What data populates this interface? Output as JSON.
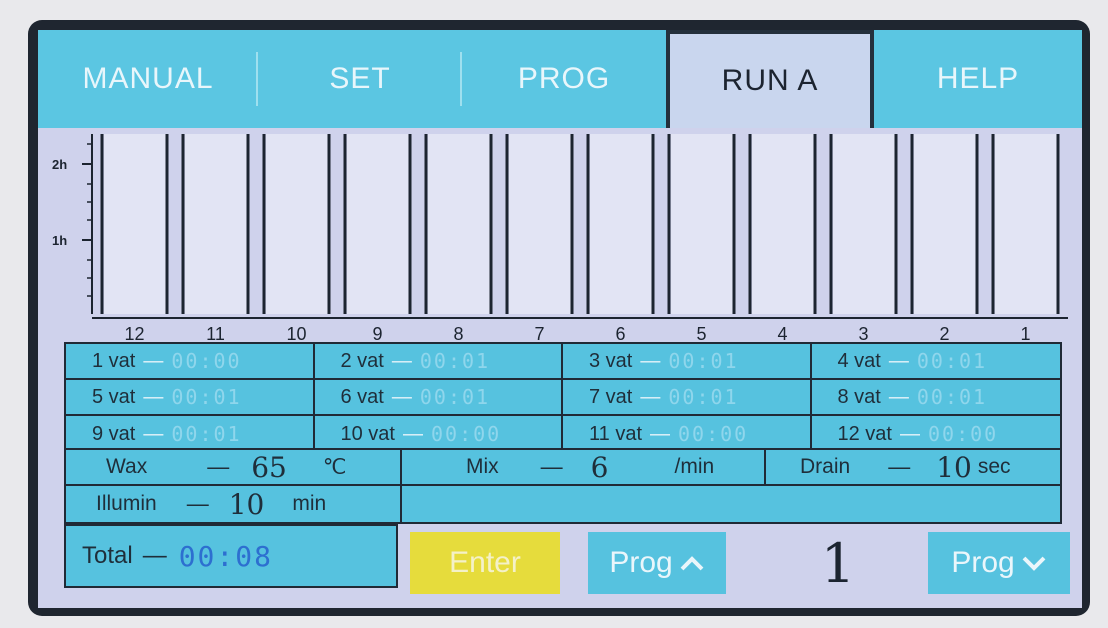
{
  "tabs": [
    {
      "label": "MANUAL",
      "active": false
    },
    {
      "label": "SET",
      "active": false
    },
    {
      "label": "PROG",
      "active": false
    },
    {
      "label": "RUN A",
      "active": true
    },
    {
      "label": "HELP",
      "active": false
    }
  ],
  "chart_data": {
    "type": "bar",
    "categories": [
      "12",
      "11",
      "10",
      "9",
      "8",
      "7",
      "6",
      "5",
      "4",
      "3",
      "2",
      "1"
    ],
    "values": [
      0,
      0,
      0,
      0,
      0,
      0,
      0,
      0,
      0,
      0,
      0,
      0
    ],
    "y_ticks": [
      "2h",
      "1h"
    ],
    "y_unit": "h"
  },
  "vats": [
    {
      "label": "1 vat",
      "time": "00:00"
    },
    {
      "label": "2 vat",
      "time": "00:01"
    },
    {
      "label": "3 vat",
      "time": "00:01"
    },
    {
      "label": "4 vat",
      "time": "00:01"
    },
    {
      "label": "5 vat",
      "time": "00:01"
    },
    {
      "label": "6 vat",
      "time": "00:01"
    },
    {
      "label": "7 vat",
      "time": "00:01"
    },
    {
      "label": "8 vat",
      "time": "00:01"
    },
    {
      "label": "9 vat",
      "time": "00:01"
    },
    {
      "label": "10 vat",
      "time": "00:00"
    },
    {
      "label": "11 vat",
      "time": "00:00"
    },
    {
      "label": "12 vat",
      "time": "00:00"
    }
  ],
  "params": {
    "wax": {
      "label": "Wax",
      "value": "65",
      "unit": "℃"
    },
    "mix": {
      "label": "Mix",
      "value": "6",
      "unit": "/min"
    },
    "drain": {
      "label": "Drain",
      "value": "10",
      "unit": "sec"
    },
    "illumin": {
      "label": "Illumin",
      "value": "10",
      "unit": "min"
    }
  },
  "total": {
    "label": "Total",
    "value": "00:08"
  },
  "buttons": {
    "enter": "Enter",
    "prog_up": "Prog",
    "prog_down": "Prog"
  },
  "program_number": "1",
  "colors": {
    "tab_bg": "#5bc6e2",
    "active_tab": "#c9d6ee",
    "cell_bg": "#56c2df",
    "enter_button": "#e6dc3c",
    "screen_bg": "#cfd2ec"
  }
}
